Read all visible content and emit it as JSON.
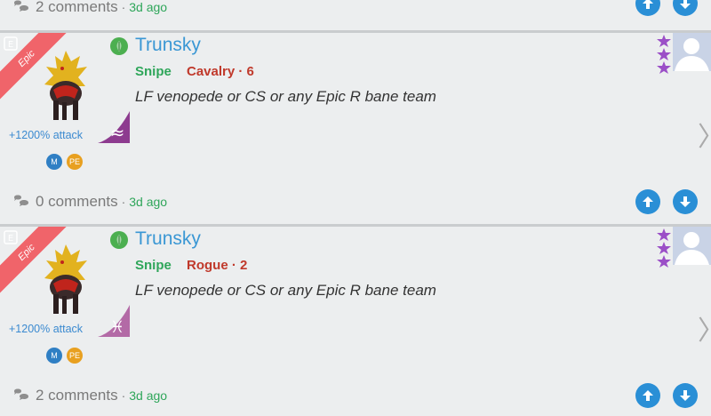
{
  "top_partial": {
    "comments": "2 comments",
    "dot": "·",
    "ago": "3d ago"
  },
  "posts": [
    {
      "rarity": "Epic",
      "username": "Trunsky",
      "role": "Snipe",
      "class_text": "Cavalry · 6",
      "message": "LF venopede or CS or any Epic R bane team",
      "bonus": "+1200% attack",
      "pills": [
        "M",
        "PE"
      ],
      "element_symbol": "≈",
      "comments": "0 comments",
      "dot": "·",
      "ago": "3d ago"
    },
    {
      "rarity": "Epic",
      "username": "Trunsky",
      "role": "Snipe",
      "class_text": "Rogue · 2",
      "message": "LF venopede or CS or any Epic R bane team",
      "bonus": "+1200% attack",
      "pills": [
        "M",
        "PE"
      ],
      "element_symbol": "♓",
      "comments": "2 comments",
      "dot": "·",
      "ago": "3d ago"
    }
  ],
  "colors": {
    "background": "#eceeef",
    "username": "#3a97d4",
    "role": "#2fa65a",
    "class": "#c0392b",
    "vote": "#2a8fd6",
    "ribbon": "#f0646a",
    "star": "#9b4fc7",
    "pill_m": "#2f7fc4",
    "pill_pe": "#e8a020"
  }
}
